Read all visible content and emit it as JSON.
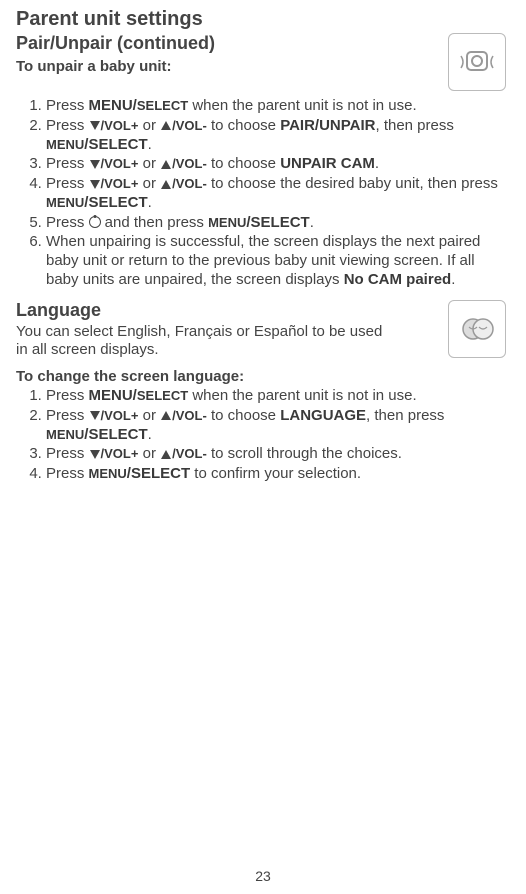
{
  "page_number": "23",
  "title": "Parent unit settings",
  "section1": {
    "heading": "Pair/Unpair (continued)",
    "subheading": "To unpair a baby unit:",
    "steps": {
      "s1a": "Press ",
      "s1b": "MENU/",
      "s1c": "SELECT",
      "s1d": " when the parent unit is not in use.",
      "s2a": "Press ",
      "s2b": "/VOL+",
      "s2c": " or ",
      "s2d": "/VOL-",
      "s2e": " to choose ",
      "s2f": "PAIR/UNPAIR",
      "s2g": ", then press ",
      "s2h": "MENU",
      "s2i": "/SELECT",
      "s2j": ".",
      "s3a": "Press ",
      "s3b": "/VOL+",
      "s3c": " or ",
      "s3d": "/VOL-",
      "s3e": " to choose ",
      "s3f": "UNPAIR CAM",
      "s3g": ".",
      "s4a": "Press ",
      "s4b": "/VOL+",
      "s4c": " or ",
      "s4d": "/VOL-",
      "s4e": " to choose the desired baby unit, then press ",
      "s4f": "MENU",
      "s4g": "/SELECT",
      "s4h": ".",
      "s5a": "Press ",
      "s5b": " and then press ",
      "s5c": "MENU",
      "s5d": "/SELECT",
      "s5e": ".",
      "s6a": "When unpairing is successful, the screen displays the next paired baby unit or return to the previous baby unit viewing screen. If all baby units are unpaired, the screen displays ",
      "s6b": "No CAM paired",
      "s6c": "."
    }
  },
  "section2": {
    "heading": "Language",
    "intro": "You can select English, Français or Español to be used in all screen displays.",
    "subheading": "To change the screen language:",
    "steps": {
      "s1a": "Press ",
      "s1b": "MENU/",
      "s1c": "SELECT",
      "s1d": " when the parent unit is not in use.",
      "s2a": "Press ",
      "s2b": "/VOL+",
      "s2c": " or ",
      "s2d": "/VOL-",
      "s2e": " to choose ",
      "s2f": "LANGUAGE",
      "s2g": ", then press ",
      "s2h": "MENU",
      "s2i": "/SELECT",
      "s2j": ".",
      "s3a": "Press ",
      "s3b": "/VOL+",
      "s3c": " or ",
      "s3d": "/VOL-",
      "s3e": " to scroll through the choices.",
      "s4a": "Press ",
      "s4b": "MENU",
      "s4c": "/SELECT",
      "s4d": " to confirm your selection."
    }
  }
}
